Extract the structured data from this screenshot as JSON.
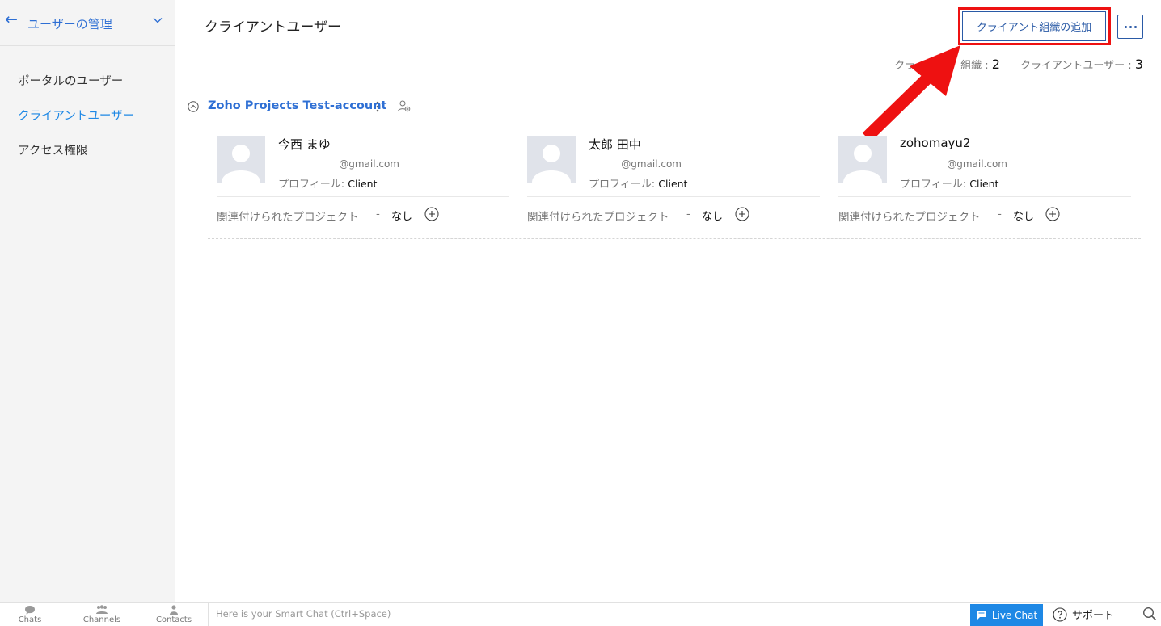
{
  "sidebar": {
    "back_icon": "arrow-left-icon",
    "title": "ユーザーの管理",
    "items": [
      {
        "label": "ポータルのユーザー",
        "active": false
      },
      {
        "label": "クライアントユーザー",
        "active": true
      },
      {
        "label": "アクセス権限",
        "active": false
      }
    ]
  },
  "header": {
    "title": "クライアントユーザー",
    "add_org_label": "クライアント組織の追加"
  },
  "stats": {
    "org_label_visible": "クラ",
    "org_label_tail": "組織 : ",
    "org_count": "2",
    "user_label": "クライアントユーザー : ",
    "user_count": "3"
  },
  "org": {
    "name": "Zoho Projects Test-account"
  },
  "users": [
    {
      "name": "今西 まゆ",
      "email": "@gmail.com",
      "profile_label": "プロフィール:",
      "profile": "Client",
      "projects_label": "関連付けられたプロジェクト",
      "dash": "-",
      "projects": "なし"
    },
    {
      "name": "太郎 田中",
      "email": "@gmail.com",
      "profile_label": "プロフィール:",
      "profile": "Client",
      "projects_label": "関連付けられたプロジェクト",
      "dash": "-",
      "projects": "なし"
    },
    {
      "name": "zohomayu2",
      "email": "@gmail.com",
      "profile_label": "プロフィール:",
      "profile": "Client",
      "projects_label": "関連付けられたプロジェクト",
      "dash": "-",
      "projects": "なし"
    }
  ],
  "bottombar": {
    "chats": "Chats",
    "channels": "Channels",
    "contacts": "Contacts",
    "smart_chat_placeholder": "Here is your Smart Chat (Ctrl+Space)",
    "live_chat": "Live Chat",
    "support": "サポート"
  },
  "colors": {
    "accent": "#2e6fd4",
    "active_nav": "#1e88e5",
    "highlight_frame": "#ee1111",
    "live_chat_bg": "#1e88e5"
  }
}
